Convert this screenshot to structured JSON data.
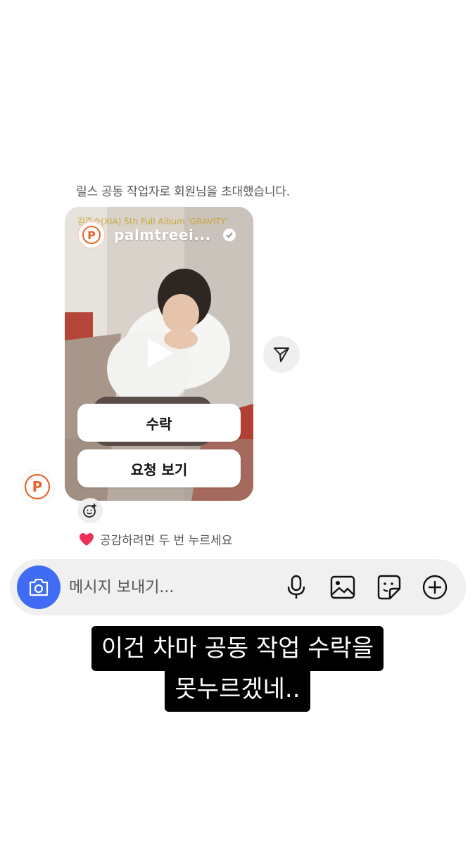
{
  "chat": {
    "notice": "릴스 공동 작업자로 회원님을 초대했습니다.",
    "like_hint": "공감하려면 두 번 누르세요",
    "like_hint_icon": "heart-icon"
  },
  "reel": {
    "caption": "김준수(XIA) 5th Full Album 'GRAVITY'",
    "username": "palmtreei...",
    "avatar_text": "P",
    "accept_label": "수락",
    "view_request_label": "요청 보기",
    "accent_color": "#e8642c"
  },
  "composer": {
    "placeholder": "메시지 보내기...",
    "camera_color": "#3f6bf5"
  },
  "overlay": {
    "line1": "이건 차마 공동 작업 수락을",
    "line2": "못누르겠네.."
  }
}
